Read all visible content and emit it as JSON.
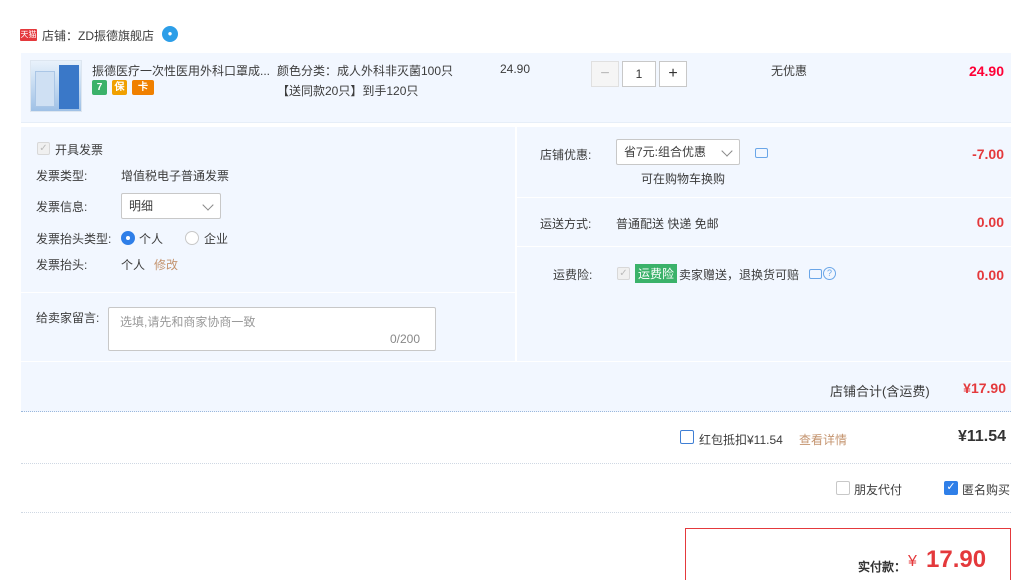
{
  "shop": {
    "tmall_logo": "天猫",
    "label": "店铺：ZD振德旗舰店"
  },
  "item": {
    "title": "振德医疗一次性医用外科口罩成...",
    "badges": [
      {
        "text": "7",
        "color": "#3bb26a"
      },
      {
        "text": "保",
        "color": "#f0a000"
      },
      {
        "text": "卡",
        "color": "#f08000"
      }
    ],
    "sku": "颜色分类：成人外科非灭菌100只",
    "gift": "【送同款20只】到手120只",
    "unit_price": "24.90",
    "qty_minus": "−",
    "quantity": "1",
    "qty_plus": "+",
    "discount_note": "无优惠",
    "total": "24.90"
  },
  "invoice": {
    "checkbox_label": "开具发票",
    "type_label": "发票类型:",
    "type_value": "增值税电子普通发票",
    "info_label": "发票信息:",
    "info_value": "明细",
    "title_type_label": "发票抬头类型:",
    "title_type_options": [
      "个人",
      "企业"
    ],
    "title_label": "发票抬头:",
    "title_value": "个人",
    "edit_link": "修改"
  },
  "message": {
    "label": "给卖家留言:",
    "placeholder": "选填,请先和商家协商一致",
    "count": "0/200"
  },
  "shop_discount": {
    "label": "店铺优惠:",
    "select_value": "省7元:组合优惠",
    "note": "可在购物车换购",
    "amount": "-7.00"
  },
  "shipping": {
    "label": "运送方式:",
    "value": "普通配送 快递 免邮",
    "amount": "0.00"
  },
  "insurance": {
    "label": "运费险:",
    "tag": "运费险",
    "desc": "卖家赠送，退换货可赔",
    "amount": "0.00"
  },
  "summary": {
    "label": "店铺合计(含运费)",
    "amount": "¥17.90"
  },
  "red_packet": {
    "label": "红包抵扣¥11.54",
    "link": "查看详情",
    "amount": "¥11.54"
  },
  "options": {
    "friend_pay": "朋友代付",
    "anonymous": "匿名购买"
  },
  "final": {
    "label": "实付款：",
    "currency": "¥",
    "amount": "17.90"
  },
  "colors": {
    "accent_red": "#e4393c",
    "row_bg": "#f2f7ff",
    "link_blue": "#2f7fe8"
  }
}
